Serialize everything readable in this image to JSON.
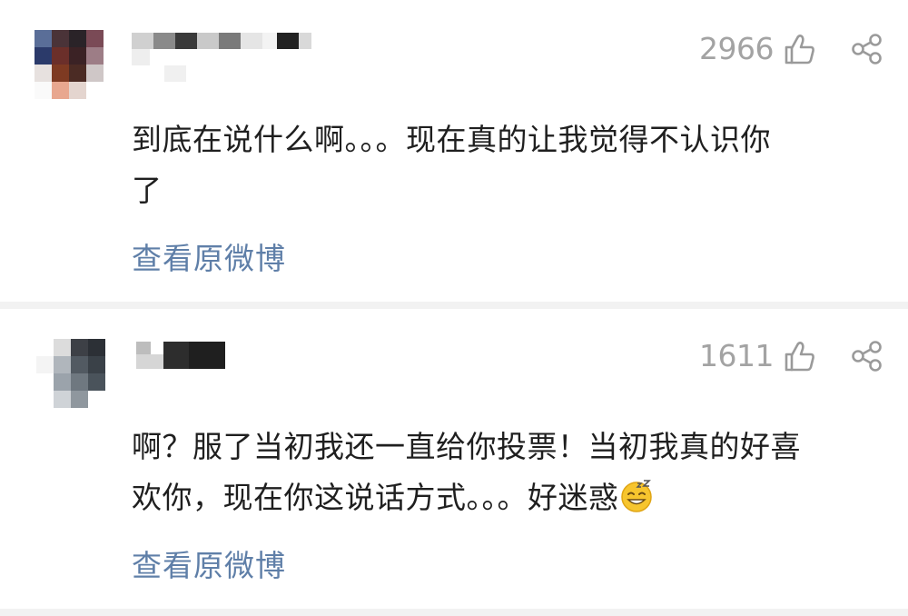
{
  "comments": [
    {
      "likes": "2966",
      "text_line1": "到底在说什么啊。。。现在真的让我觉得不认识你",
      "text_line2": "了",
      "link": "查看原微博"
    },
    {
      "likes": "1611",
      "text_line1": "啊？服了当初我还一直给你投票！当初我真的好喜",
      "text_line2": "欢你，现在你这说话方式。。。好迷惑",
      "emoji": "grinning-sweat-emoji",
      "link": "查看原微博"
    }
  ],
  "icons": {
    "like": "thumbs-up-icon",
    "share": "share-icon"
  },
  "colors": {
    "text": "#1f1f1f",
    "muted": "#a3a3a3",
    "link": "#5f7fa8",
    "separator": "#f2f2f2"
  }
}
